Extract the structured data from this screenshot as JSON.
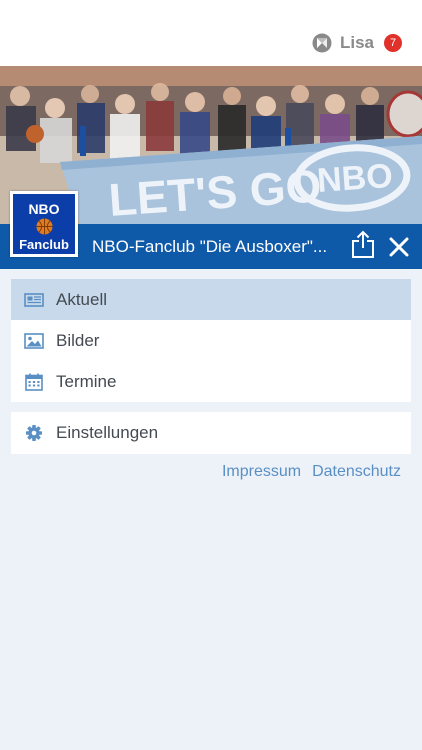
{
  "header": {
    "user_name": "Lisa",
    "notification_count": "7"
  },
  "club": {
    "logo_line1": "NBO",
    "logo_line2": "Fanclub",
    "banner_text": "LET'S GO",
    "banner_brand": "NBO",
    "title": "NBO-Fanclub \"Die Ausboxer\"..."
  },
  "menu": {
    "items": [
      {
        "label": "Aktuell",
        "icon": "newspaper-icon",
        "active": true
      },
      {
        "label": "Bilder",
        "icon": "image-icon",
        "active": false
      },
      {
        "label": "Termine",
        "icon": "calendar-icon",
        "active": false
      }
    ],
    "settings_label": "Einstellungen"
  },
  "footer": {
    "impressum": "Impressum",
    "datenschutz": "Datenschutz"
  },
  "colors": {
    "brand_blue": "#0f5aa8",
    "active_row": "#c7d9eb",
    "background": "#edf2f9",
    "badge_red": "#e0312b",
    "link_blue": "#5a8fc4"
  }
}
